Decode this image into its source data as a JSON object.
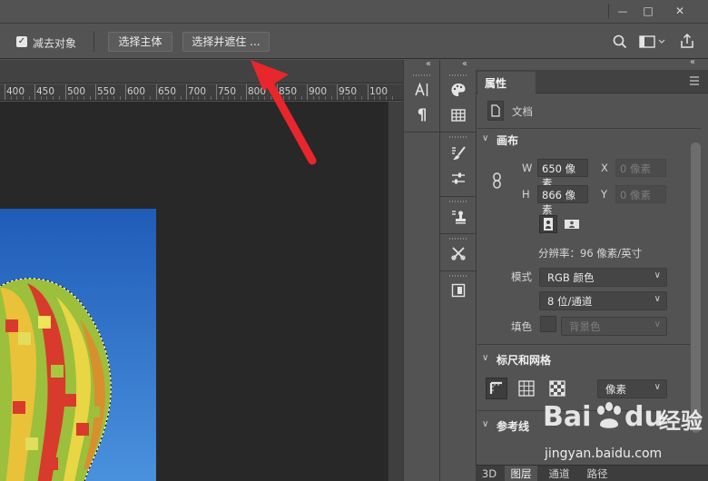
{
  "window": {
    "minimize": "—",
    "maximize": "□",
    "close": "✕"
  },
  "options": {
    "subtract_label": "减去对象",
    "select_subject": "选择主体",
    "select_and_mask": "选择并遮住 ..."
  },
  "ruler": {
    "ticks": [
      "400",
      "450",
      "500",
      "550",
      "600",
      "650",
      "700",
      "750",
      "800",
      "850",
      "900",
      "950",
      "100"
    ]
  },
  "panel_collapse": "‹‹",
  "properties": {
    "tab": "属性",
    "doc_label": "文档",
    "canvas": {
      "title": "画布",
      "w_label": "W",
      "w_value": "650 像素",
      "h_label": "H",
      "h_value": "866 像素",
      "x_label": "X",
      "x_value": "0 像素",
      "y_label": "Y",
      "y_value": "0 像素",
      "resolution": "分辨率：96 像素/英寸",
      "mode_label": "模式",
      "mode_value": "RGB 颜色",
      "depth_value": "8 位/通道",
      "fill_label": "填色",
      "fill_value": "背景色"
    },
    "rulers_grids": {
      "title": "标尺和网格",
      "unit": "像素"
    },
    "guides": {
      "title": "参考线"
    }
  },
  "bottom_tabs": [
    "3D",
    "图层",
    "通道",
    "路径"
  ],
  "watermark": {
    "brand": "Bai",
    "brand2": "du",
    "cn": "经验",
    "url": "jingyan.baidu.com"
  },
  "colors": {
    "accent_arrow": "#e8262b",
    "sky": "#2f70c4"
  }
}
